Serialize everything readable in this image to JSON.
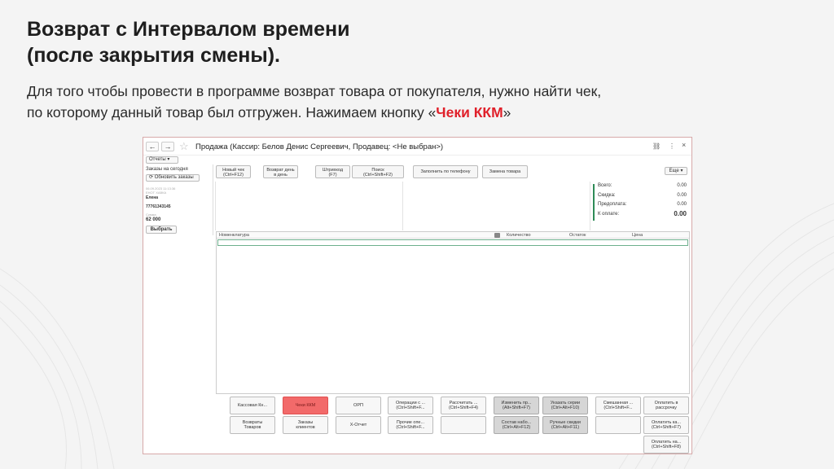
{
  "slide": {
    "title_line1": "Возврат с Интервалом времени",
    "title_line2": "(после закрытия смены).",
    "intro_line1": "Для того чтобы провести в программе возврат товара от покупателя, нужно найти чек,",
    "intro_line2_before": "по которому данный товар был отгружен. Нажимаем кнопку «",
    "intro_highlight": "Чеки ККМ",
    "intro_line2_after": "»",
    "highlight_color": "#e0202a"
  },
  "window": {
    "back": "←",
    "forward": "→",
    "title": "Продажа (Кассир: Белов Денис Сергеевич, Продавец: <Не выбран>)",
    "link_icon": "link-icon",
    "menu_icon": "more-vertical-icon",
    "close": "×"
  },
  "left_panel": {
    "reports_label": "Отчеты",
    "orders_today": "Заказы на сегодня",
    "refresh_label": "Обновить заказы",
    "order_meta_line1": "06.09.2023 11:13:36",
    "order_meta_line2": "ЕНОТ ХАВКА",
    "customer_name": "Елена",
    "customer_phone": "77761343145",
    "sum_label": "Сумма",
    "sum_value": "62 000",
    "select_label": "Выбрать"
  },
  "toolbar": {
    "new_check_l1": "Новый чек",
    "new_check_l2": "(Ctrl+F12)",
    "return_day_l1": "Возврат день",
    "return_day_l2": "в день",
    "barcode_l1": "Штрихкод",
    "barcode_l2": "(F7)",
    "search_l1": "Поиск",
    "search_l2": "(Ctrl+Shift+F2)",
    "fill_phone": "Заполнить по телефону",
    "replace_goods": "Замена товара",
    "more_label": "Еще"
  },
  "totals": {
    "total_label": "Всего:",
    "total_value": "0.00",
    "discount_label": "Скидка:",
    "discount_value": "0.00",
    "prepay_label": "Предоплата:",
    "prepay_value": "0.00",
    "topay_label": "К оплате:",
    "topay_value": "0.00"
  },
  "table": {
    "col_name": "Номенклатура",
    "col_qty": "Количество",
    "col_rest": "Остаток",
    "col_price": "Цена"
  },
  "bottom": {
    "cash_ops": "Кассовая Кн...",
    "kkm_checks": "Чеки ККМ",
    "orp": "ОРП",
    "ops_l1": "Операции с ...",
    "ops_l2": "(Ctrl+Shift+F...",
    "calc_l1": "Рассчитать ...",
    "calc_l2": "(Ctrl+Shift+F4)",
    "change_l1": "Изменить пр...",
    "change_l2": "(Alt+Shift+F7)",
    "series_l1": "Указать серии",
    "series_l2": "(Ctrl+Alt+F10)",
    "mixed_l1": "Смешанная ...",
    "mixed_l2": "(Ctrl+Shift+F...",
    "installment_l1": "Оплатить в",
    "installment_l2": "рассрочку",
    "returns_l1": "Возвраты",
    "returns_l2": "Товаров",
    "client_orders_l1": "Заказы",
    "client_orders_l2": "клиентов",
    "xreport": "X-Отчет",
    "other_l1": "Прочие опе...",
    "other_l2": "(Ctrl+Shift+F...",
    "kit_l1": "Состав набо...",
    "kit_l2": "(Ctrl+Alt+F12)",
    "manual_l1": "Ручные скидки",
    "manual_l2": "(Ctrl+Alt+F11)",
    "pay_card_l1": "Оплатить ка...",
    "pay_card_l2": "(Ctrl+Shift+F7)",
    "pay_cash_l1": "Оплатить на...",
    "pay_cash_l2": "(Ctrl+Shift+F8)"
  }
}
